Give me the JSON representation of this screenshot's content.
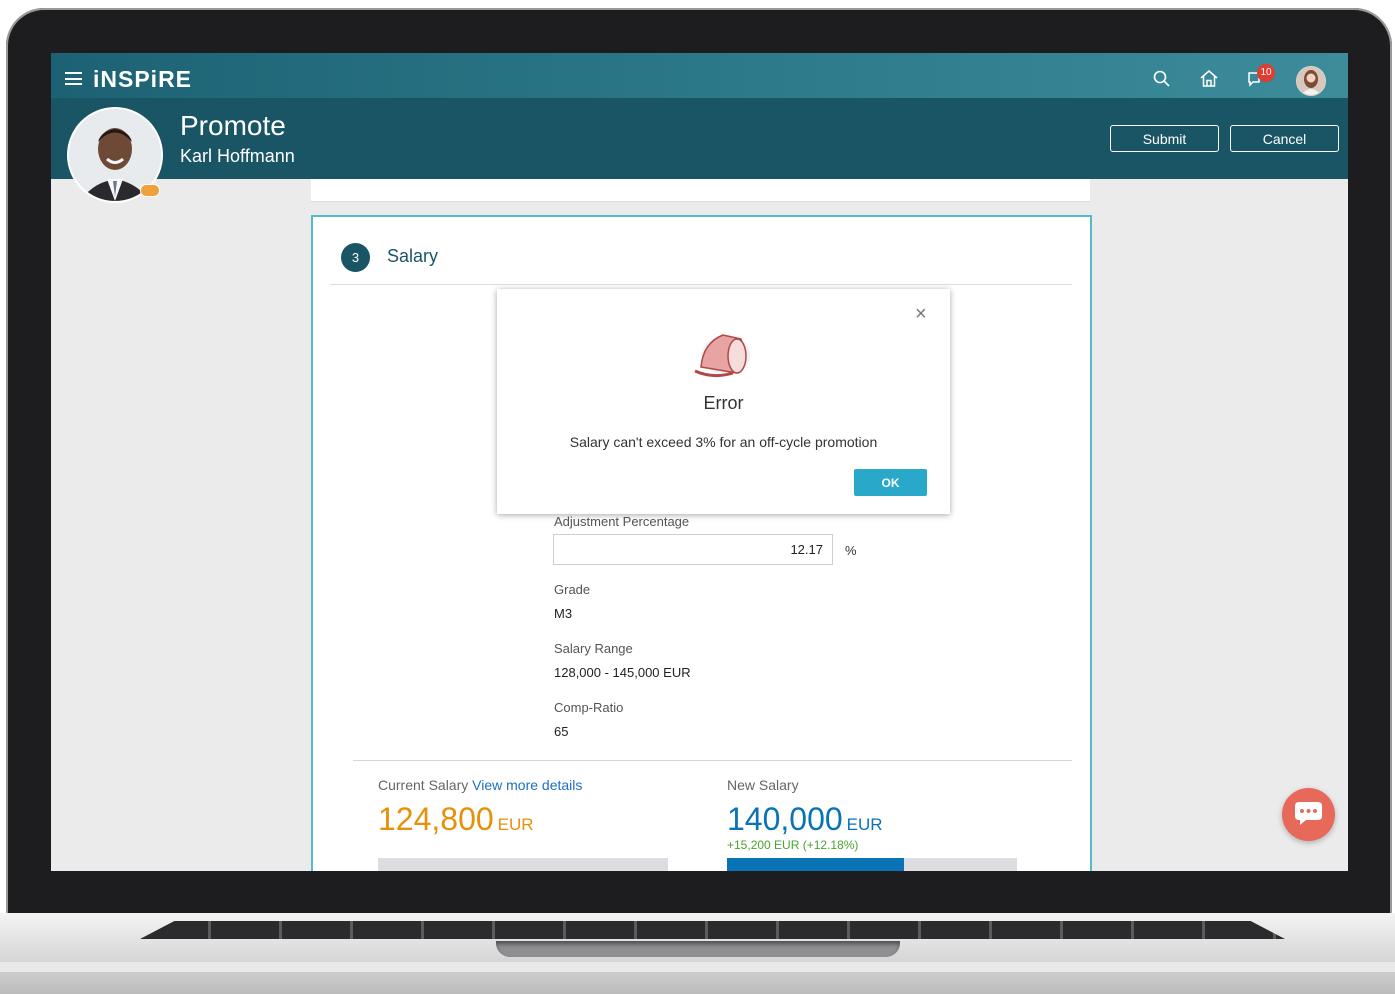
{
  "app": {
    "brand": "iNSPiRE",
    "notifications_count": "10"
  },
  "header": {
    "title": "Promote",
    "person_name": "Karl Hoffmann",
    "submit_label": "Submit",
    "cancel_label": "Cancel"
  },
  "section": {
    "step_number": "3",
    "title": "Salary",
    "fields": {
      "adjustment_label": "Adjustment Percentage",
      "adjustment_value": "12.17",
      "adjustment_unit": "%",
      "grade_label": "Grade",
      "grade_value": "M3",
      "range_label": "Salary Range",
      "range_value": "128,000 - 145,000 EUR",
      "compratio_label": "Comp-Ratio",
      "compratio_value": "65"
    },
    "current_salary": {
      "label": "Current Salary",
      "link": "View more details",
      "amount": "124,800",
      "currency": "EUR",
      "bar_fraction": 1.0
    },
    "new_salary": {
      "label": "New Salary",
      "amount": "140,000",
      "currency": "EUR",
      "change": "+15,200 EUR (+12.18%)",
      "bar_fraction": 0.61
    }
  },
  "dialog": {
    "title": "Error",
    "message": "Salary can't exceed 3% for an off-cycle promotion",
    "ok_label": "OK"
  },
  "colors": {
    "header_bg": "#1a5565",
    "accent": "#55bacb",
    "current_salary": "#e8900a",
    "new_salary": "#0a73b6",
    "ok_button": "#2aa8c9"
  }
}
